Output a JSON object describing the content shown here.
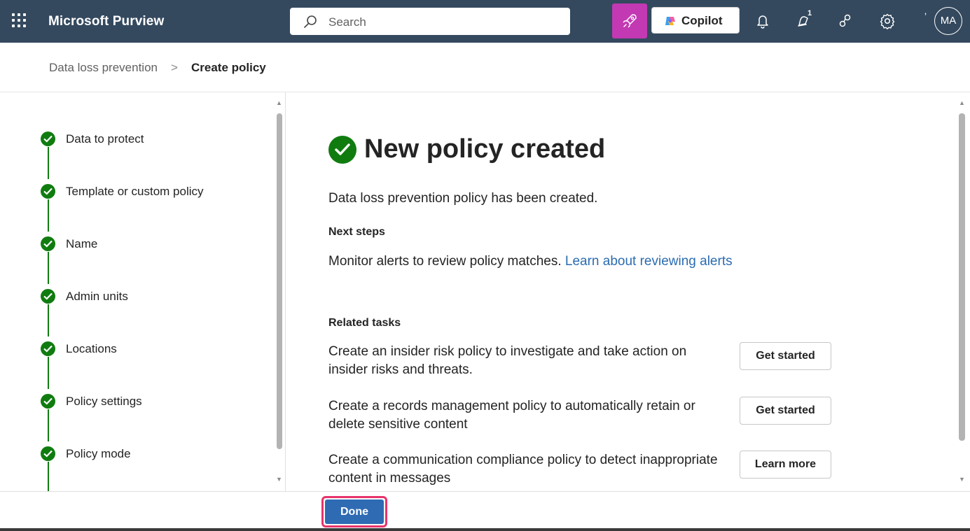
{
  "header": {
    "app_title": "Microsoft Purview",
    "search_placeholder": "Search",
    "copilot_label": "Copilot",
    "notification_badge": "1",
    "avatar_initials": "MA",
    "colors": {
      "topbar": "#34495e",
      "rocket": "#c239b3"
    }
  },
  "breadcrumb": {
    "parent": "Data loss prevention",
    "separator": ">",
    "current": "Create policy"
  },
  "steps": [
    {
      "label": "Data to protect",
      "status": "complete"
    },
    {
      "label": "Template or custom policy",
      "status": "complete"
    },
    {
      "label": "Name",
      "status": "complete"
    },
    {
      "label": "Admin units",
      "status": "complete"
    },
    {
      "label": "Locations",
      "status": "complete"
    },
    {
      "label": "Policy settings",
      "status": "complete"
    },
    {
      "label": "Policy mode",
      "status": "complete"
    }
  ],
  "main": {
    "title": "New policy created",
    "description": "Data loss prevention policy has been created.",
    "next_steps_heading": "Next steps",
    "monitor_text": "Monitor alerts to review policy matches.",
    "monitor_link": "Learn about reviewing alerts",
    "related_heading": "Related tasks",
    "tasks": [
      {
        "text": "Create an insider risk policy to investigate and take action on insider risks and threats.",
        "button": "Get started"
      },
      {
        "text": "Create a records management policy to automatically retain or delete sensitive content",
        "button": "Get started"
      },
      {
        "text": "Create a communication compliance policy to detect inappropriate content in messages",
        "button": "Learn more"
      }
    ]
  },
  "footer": {
    "done_label": "Done"
  },
  "accent_colors": {
    "success": "#107c10",
    "primary": "#2f6bb3",
    "highlight": "#e8336b",
    "link": "#2b6cb0"
  }
}
